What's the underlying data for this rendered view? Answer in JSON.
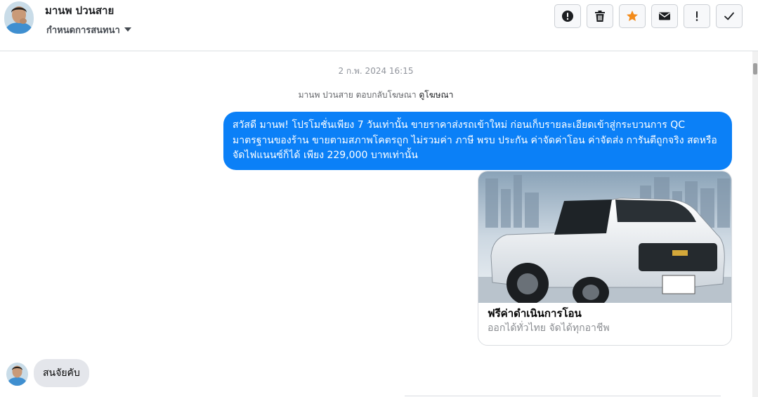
{
  "header": {
    "contact_name": "มานพ ปวนสาย",
    "conversation_settings": "กำหนดการสนทนา",
    "toolbar": [
      {
        "name": "report-spam-button",
        "icon": "exclamation-circle-icon"
      },
      {
        "name": "delete-button",
        "icon": "trash-icon"
      },
      {
        "name": "star-button",
        "icon": "star-icon"
      },
      {
        "name": "mark-unread-button",
        "icon": "envelope-icon"
      },
      {
        "name": "follow-up-button",
        "icon": "exclamation-icon"
      },
      {
        "name": "mark-done-button",
        "icon": "check-icon"
      }
    ]
  },
  "thread": {
    "timestamp": "2 ก.พ. 2024 16:15",
    "ad_reply_prefix": "มานพ ปวนสาย ตอบกลับโฆษณา",
    "ad_reply_link": "ดูโฆษณา",
    "outgoing_message": "สวัสดี มานพ! โปรโมชั่นเพียง 7 วันเท่านั้น ขายราคาส่งรถเข้าใหม่ ก่อนเก็บรายละเอียดเข้าสู่กระบวนการ QC มาตรฐานของร้าน ขายตามสภาพโคตรถูก ไม่รวมค่า ภาษี พรบ ประกัน ค่าจัดค่าโอน ค่าจัดส่ง การันตีถูกจริง สดหรือจัดไฟแนนซ์ก็ได้ เพียง 229,000 บาทเท่านั้น",
    "ad_card": {
      "title": "ฟรีค่าดำเนินการโอน",
      "subtitle": "ออกได้ทั่วไทย จัดได้ทุกอาชีพ"
    },
    "incoming_message": "สนจัยคับ"
  },
  "colors": {
    "accent_blue": "#0b80f7",
    "star_orange": "#f38b1a",
    "incoming_bubble": "#e4e6eb"
  }
}
